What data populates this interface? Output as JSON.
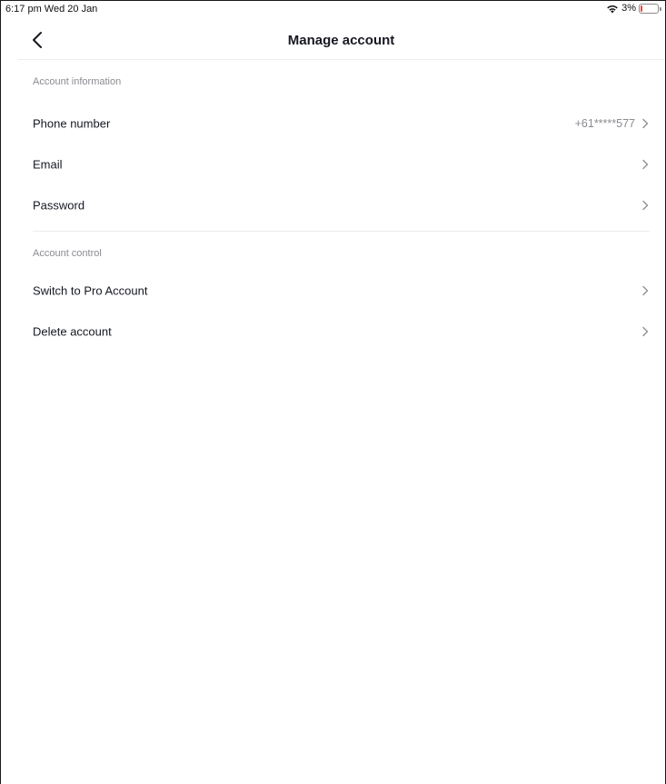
{
  "status_bar": {
    "time": "6:17 pm  Wed 20 Jan",
    "wifi_icon": "wifi-icon",
    "battery_percent": "3%",
    "battery_color": "#ff3b30",
    "battery_level": 0.03
  },
  "header": {
    "back_icon": "chevron-left-icon",
    "title": "Manage account"
  },
  "sections": [
    {
      "title": "Account information",
      "items": [
        {
          "label": "Phone number",
          "value": "+61*****577"
        },
        {
          "label": "Email",
          "value": ""
        },
        {
          "label": "Password",
          "value": ""
        }
      ]
    },
    {
      "title": "Account control",
      "items": [
        {
          "label": "Switch to Pro Account",
          "value": ""
        },
        {
          "label": "Delete account",
          "value": ""
        }
      ]
    }
  ],
  "colors": {
    "primary_text": "#161823",
    "secondary_text": "#8a8b91",
    "divider": "#ececec"
  }
}
